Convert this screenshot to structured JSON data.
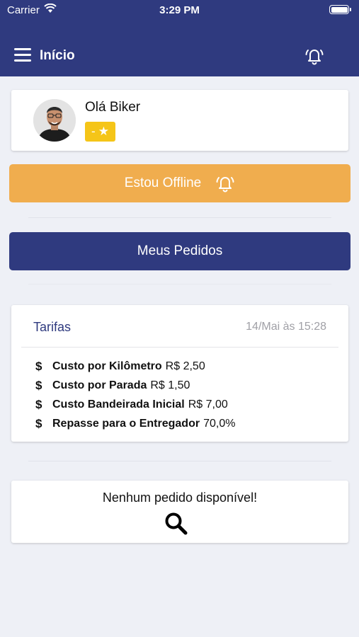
{
  "status_bar": {
    "carrier": "Carrier",
    "time": "3:29 PM"
  },
  "nav": {
    "title": "Início",
    "menu_icon": "menu-icon",
    "bell_icon": "bell-icon"
  },
  "profile": {
    "greeting": "Olá Biker",
    "rating": "-"
  },
  "buttons": {
    "offline_label": "Estou Offline",
    "pedidos_label": "Meus Pedidos"
  },
  "tarifas": {
    "title": "Tarifas",
    "date": "14/Mai às 15:28",
    "rows": [
      {
        "label": "Custo por Kilômetro",
        "value": "R$ 2,50"
      },
      {
        "label": "Custo por Parada",
        "value": "R$ 1,50"
      },
      {
        "label": "Custo Bandeirada Inicial",
        "value": "R$ 7,00"
      },
      {
        "label": "Repasse para o Entregador",
        "value": "70,0%"
      }
    ]
  },
  "orders": {
    "empty_text": "Nenhum pedido disponível!"
  },
  "colors": {
    "primary": "#2f3a7f",
    "offline": "#f0ad4e",
    "badge": "#f5c518"
  }
}
